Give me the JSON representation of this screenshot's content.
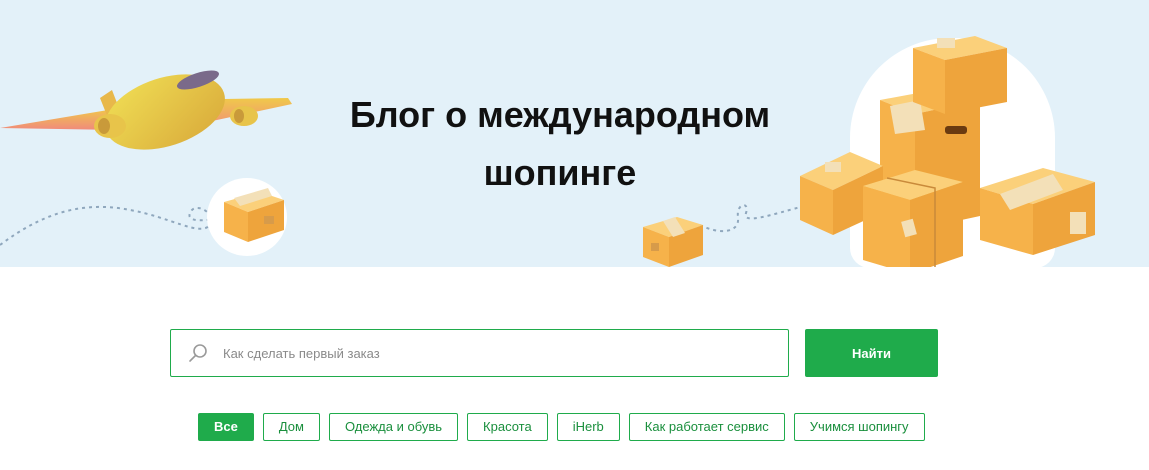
{
  "hero": {
    "title_line1": "Блог о международном",
    "title_line2": "шопинге"
  },
  "search": {
    "placeholder": "Как сделать первый заказ",
    "button_label": "Найти",
    "icon": "search-icon"
  },
  "categories": [
    {
      "label": "Все",
      "active": true
    },
    {
      "label": "Дом",
      "active": false
    },
    {
      "label": "Одежда и обувь",
      "active": false
    },
    {
      "label": "Красота",
      "active": false
    },
    {
      "label": "iHerb",
      "active": false
    },
    {
      "label": "Как работает сервис",
      "active": false
    },
    {
      "label": "Учимся шопингу",
      "active": false
    }
  ],
  "colors": {
    "accent": "#1fab4b",
    "hero_bg": "#e3f1f9",
    "box": "#f6b24a",
    "plane": "#e9d040"
  }
}
